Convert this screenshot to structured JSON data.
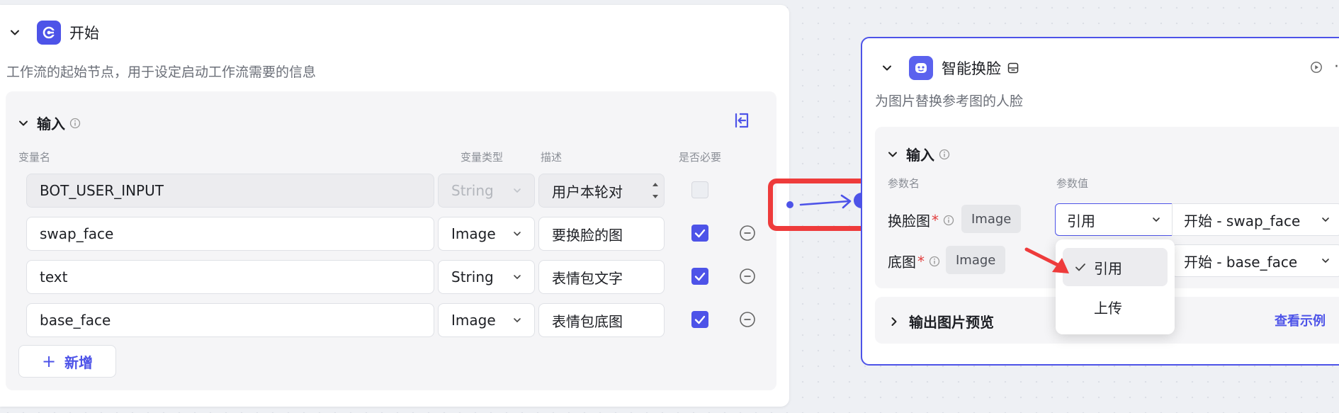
{
  "start_node": {
    "title": "开始",
    "description": "工作流的起始节点，用于设定启动工作流需要的信息",
    "inputs_title": "输入",
    "columns": {
      "name": "变量名",
      "type": "变量类型",
      "desc": "描述",
      "required": "是否必要"
    },
    "rows": [
      {
        "name": "BOT_USER_INPUT",
        "type": "String",
        "desc": "用户本轮对",
        "required": false,
        "disabled": true
      },
      {
        "name": "swap_face",
        "type": "Image",
        "desc": "要换脸的图",
        "required": true
      },
      {
        "name": "text",
        "type": "String",
        "desc": "表情包文字",
        "required": true
      },
      {
        "name": "base_face",
        "type": "Image",
        "desc": "表情包底图",
        "required": true
      }
    ],
    "add_label": "新增",
    "add_symbol": "+"
  },
  "swap_node": {
    "title": "智能换脸",
    "description": "为图片替换参考图的人脸",
    "inputs_title": "输入",
    "param_name_label": "参数名",
    "param_value_label": "参数值",
    "params": [
      {
        "name": "换脸图",
        "required_mark": "*",
        "type": "Image",
        "mode": "引用",
        "value": "开始 - swap_face"
      },
      {
        "name": "底图",
        "required_mark": "*",
        "type": "Image",
        "value": "开始 - base_face"
      }
    ],
    "output_title": "输出图片预览",
    "view_example": "查看示例",
    "more": "···"
  },
  "dropdown": {
    "options": [
      "引用",
      "上传"
    ],
    "selected": "引用"
  },
  "colors": {
    "accent": "#4d53e8",
    "highlight_red": "#ee3b3b",
    "node_icon_bg": "#4d53e8"
  },
  "icons": [
    "chevron-down-icon",
    "start-node-icon",
    "info-icon",
    "collapse-panel-icon",
    "minus-circle-icon",
    "check-icon",
    "robot-face-icon",
    "storage-icon",
    "play-icon",
    "chevron-right-icon"
  ]
}
